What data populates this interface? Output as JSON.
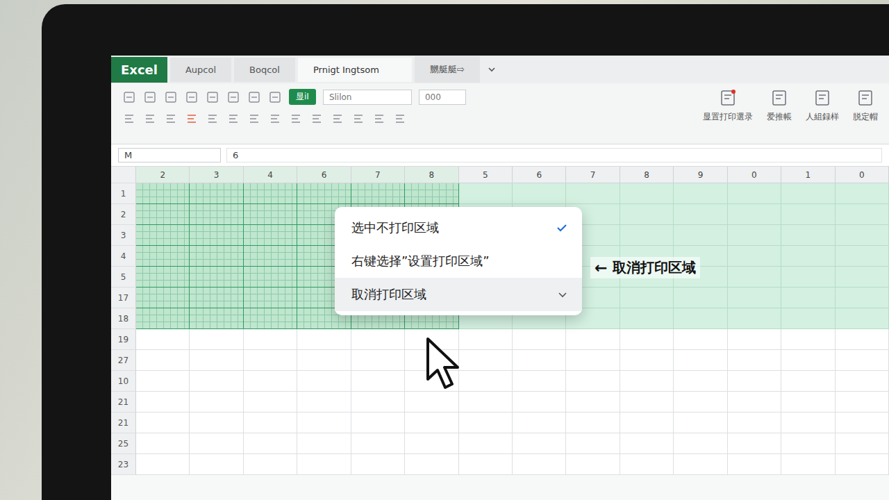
{
  "app": {
    "logo": "Excel",
    "tabs": [
      {
        "label": "Aupcol",
        "selected": false
      },
      {
        "label": "Boqcol",
        "selected": false
      },
      {
        "label": "Prnigt Ingtsom",
        "selected": true
      },
      {
        "label": "嬲艇艇⇨",
        "selected": false
      }
    ]
  },
  "ribbon": {
    "button": "显iI",
    "font_box": "Slilon",
    "size_box": "000",
    "actions": [
      {
        "label": "显置打印選录"
      },
      {
        "label": "爱推帳"
      },
      {
        "label": "人組録样"
      },
      {
        "label": "脱定帽"
      }
    ]
  },
  "formula_bar": {
    "name_box": "M",
    "value": "6"
  },
  "sheet": {
    "columns": [
      {
        "label": "2",
        "selected": true
      },
      {
        "label": "3",
        "selected": true
      },
      {
        "label": "4",
        "selected": true
      },
      {
        "label": "6",
        "selected": true
      },
      {
        "label": "7",
        "selected": true
      },
      {
        "label": "8",
        "selected": true
      },
      {
        "label": "5",
        "selected": false
      },
      {
        "label": "6",
        "selected": false
      },
      {
        "label": "7",
        "selected": false
      },
      {
        "label": "8",
        "selected": false
      },
      {
        "label": "9",
        "selected": false
      },
      {
        "label": "0",
        "selected": false
      },
      {
        "label": "1",
        "selected": false
      },
      {
        "label": "0",
        "selected": false
      }
    ],
    "rows": [
      {
        "label": "1",
        "print_area": true
      },
      {
        "label": "2",
        "print_area": true
      },
      {
        "label": "3",
        "print_area": true
      },
      {
        "label": "4",
        "print_area": true
      },
      {
        "label": "5",
        "print_area": true
      },
      {
        "label": "17",
        "print_area": true
      },
      {
        "label": "18",
        "print_area": true
      },
      {
        "label": "19",
        "print_area": false
      },
      {
        "label": "27",
        "print_area": false
      },
      {
        "label": "10",
        "print_area": false
      },
      {
        "label": "21",
        "print_area": false
      },
      {
        "label": "21",
        "print_area": false
      },
      {
        "label": "25",
        "print_area": false
      },
      {
        "label": "23",
        "print_area": false
      }
    ]
  },
  "context_menu": {
    "items": [
      {
        "label": "选中不打印区域",
        "checked": true,
        "selected": false,
        "expandable": false
      },
      {
        "label": "右键选择”设置打印区域”",
        "checked": false,
        "selected": false,
        "expandable": false
      },
      {
        "label": "取消打印区域",
        "checked": false,
        "selected": true,
        "expandable": true
      }
    ]
  },
  "annotation": {
    "arrow": "←",
    "text": "取消打印区域"
  }
}
